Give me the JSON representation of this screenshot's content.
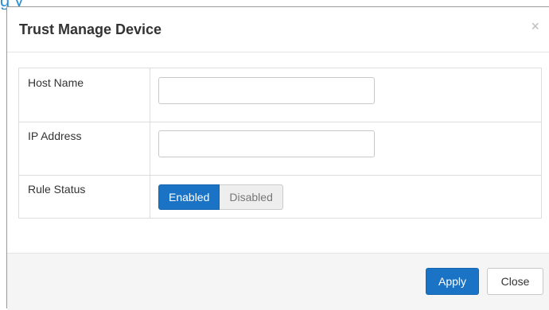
{
  "background_fragment": "g      y",
  "modal": {
    "title": "Trust Manage Device",
    "close_icon": "×"
  },
  "form": {
    "fields": [
      {
        "label": "Host Name",
        "value": "",
        "placeholder": ""
      },
      {
        "label": "IP Address",
        "value": "",
        "placeholder": ""
      }
    ],
    "rule_status": {
      "label": "Rule Status",
      "options": [
        "Enabled",
        "Disabled"
      ],
      "selected": "Enabled"
    }
  },
  "footer": {
    "apply_label": "Apply",
    "close_label": "Close"
  },
  "colors": {
    "accent": "#1a73c4",
    "link_blue": "#2f8fd6"
  }
}
